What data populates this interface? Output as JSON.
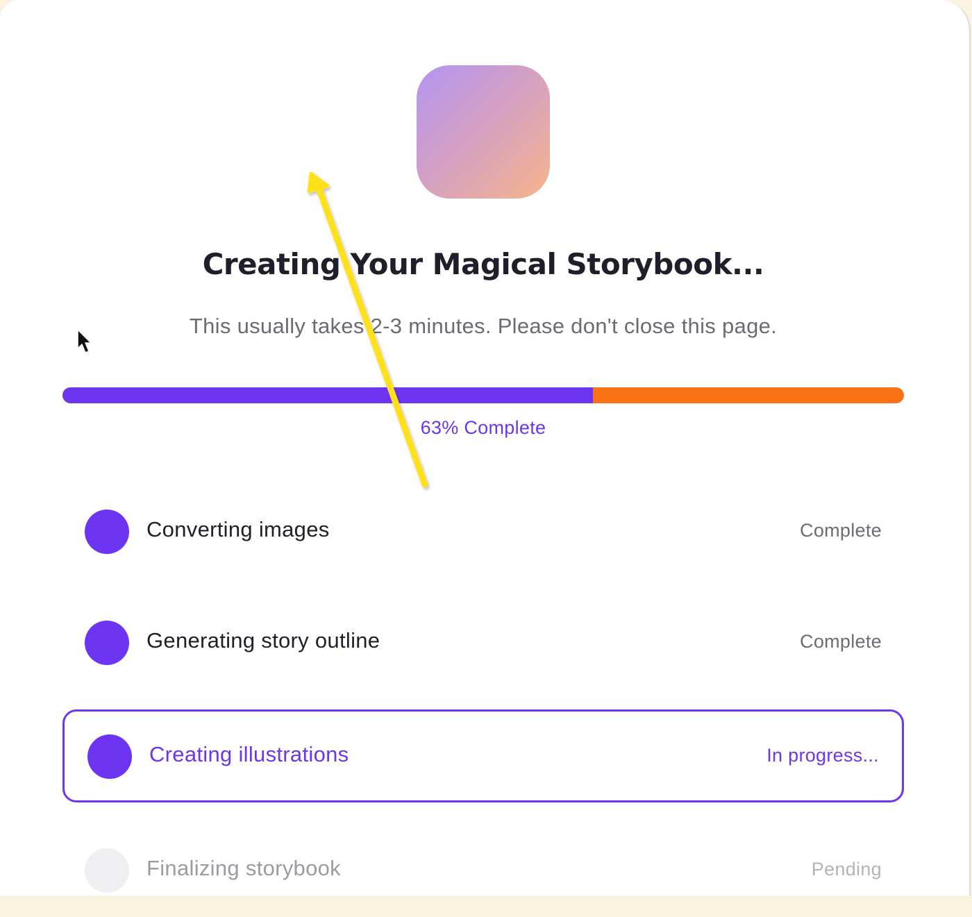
{
  "colors": {
    "accent": "#6d35f2",
    "progress_remaining": "#f97316",
    "annotation_arrow": "#ffe01a"
  },
  "header": {
    "title": "Creating Your Magical Storybook...",
    "subtitle": "This usually takes 2-3 minutes. Please don't close this page."
  },
  "progress": {
    "percent": 63,
    "label": "63% Complete"
  },
  "steps": [
    {
      "label": "Converting images",
      "status": "Complete",
      "state": "complete"
    },
    {
      "label": "Generating story outline",
      "status": "Complete",
      "state": "complete"
    },
    {
      "label": "Creating illustrations",
      "status": "In progress...",
      "state": "active"
    },
    {
      "label": "Finalizing storybook",
      "status": "Pending",
      "state": "pending"
    }
  ],
  "overlay": {
    "arrow_icon": "arrow-annotation-icon",
    "cursor_icon": "mouse-cursor-icon"
  }
}
